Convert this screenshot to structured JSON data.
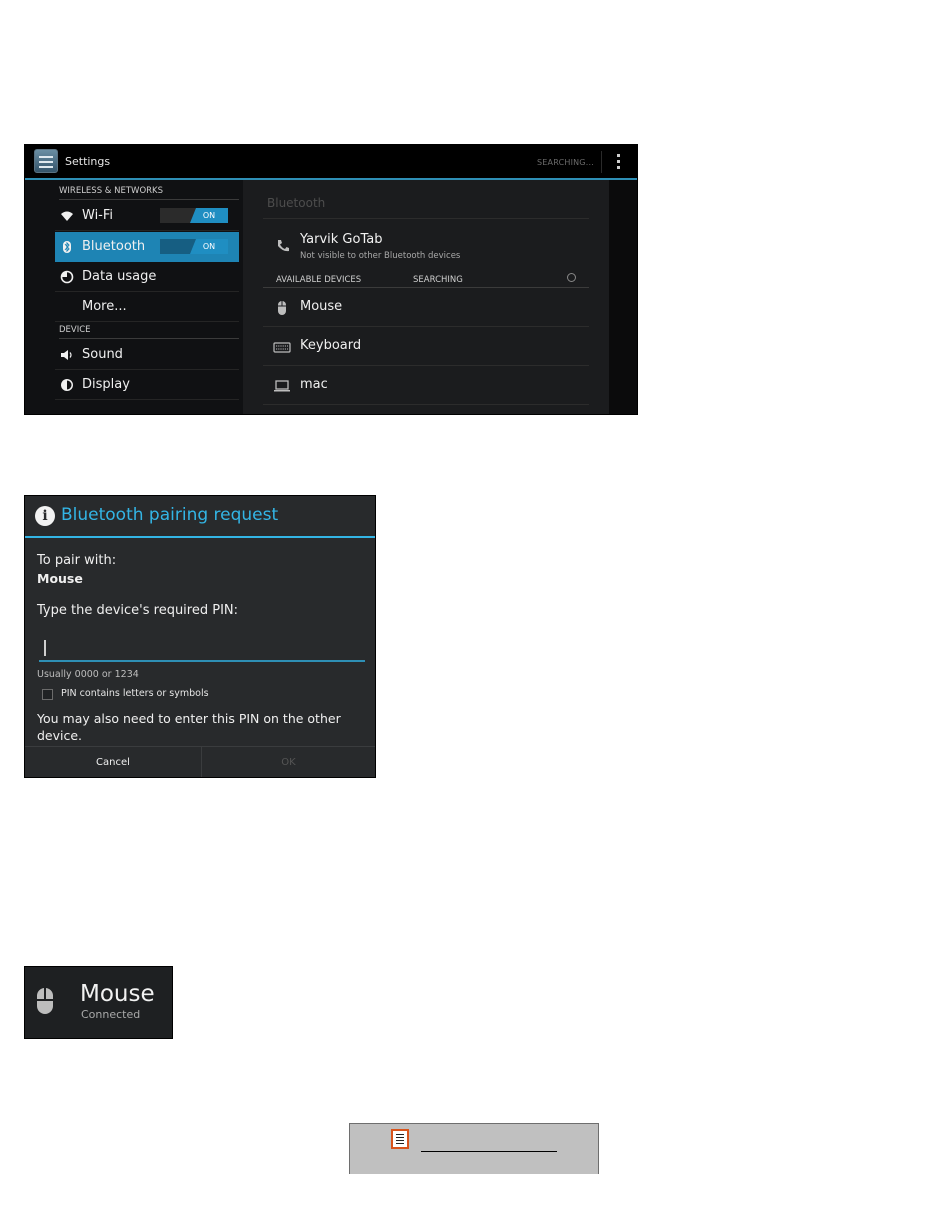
{
  "settings": {
    "title": "Settings",
    "status": "SEARCHING...",
    "sections": {
      "wireless": "WIRELESS & NETWORKS",
      "device": "DEVICE"
    },
    "nav": [
      {
        "label": "Wi-Fi",
        "icon": "wifi-icon",
        "toggle": "ON"
      },
      {
        "label": "Bluetooth",
        "icon": "bluetooth-icon",
        "toggle": "ON",
        "selected": true
      },
      {
        "label": "Data usage",
        "icon": "data-usage-icon"
      },
      {
        "label": "More..."
      },
      {
        "label": "Sound",
        "icon": "speaker-icon"
      },
      {
        "label": "Display",
        "icon": "brightness-icon"
      }
    ],
    "bluetooth": {
      "header": "Bluetooth",
      "device_name": "Yarvik GoTab",
      "device_sub": "Not visible to other Bluetooth devices",
      "available_label": "AVAILABLE DEVICES",
      "available_status": "SEARCHING",
      "devices": [
        {
          "label": "Mouse",
          "icon": "mouse-icon"
        },
        {
          "label": "Keyboard",
          "icon": "keyboard-icon"
        },
        {
          "label": "mac",
          "icon": "laptop-icon"
        }
      ]
    }
  },
  "dialog": {
    "title": "Bluetooth pairing request",
    "pair_with": "To pair with:",
    "device": "Mouse",
    "type_pin": "Type the device's required PIN:",
    "pin_value": "",
    "hint": "Usually 0000 or 1234",
    "checkbox_label": "PIN contains letters or symbols",
    "note": "You may also need to enter this PIN on the other device.",
    "cancel": "Cancel",
    "ok": "OK"
  },
  "connected": {
    "name": "Mouse",
    "status": "Connected"
  },
  "colors": {
    "accent": "#33b5e5",
    "selected": "#1e84b4",
    "note_icon_border": "#d9541c"
  }
}
